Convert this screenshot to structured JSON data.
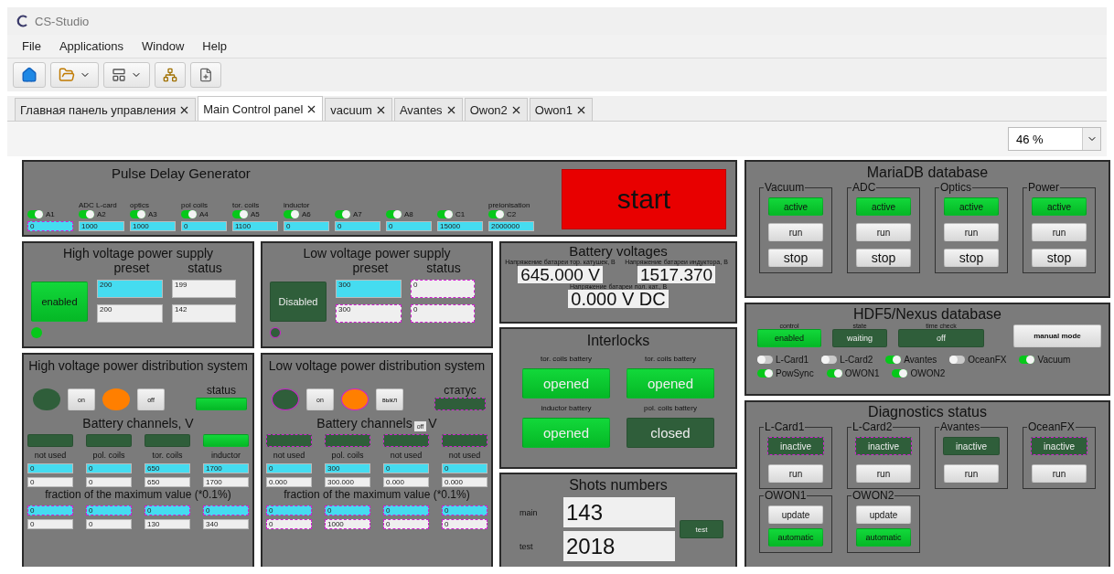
{
  "window": {
    "title": "CS-Studio"
  },
  "menu": [
    "File",
    "Applications",
    "Window",
    "Help"
  ],
  "tabs": [
    {
      "label": "Главная панель управления",
      "selected": false
    },
    {
      "label": "Main Control panel",
      "selected": true
    },
    {
      "label": "vacuum",
      "selected": false
    },
    {
      "label": "Avantes",
      "selected": false
    },
    {
      "label": "Owon2",
      "selected": false
    },
    {
      "label": "Owon1",
      "selected": false
    }
  ],
  "zoom": {
    "value": "46 %"
  },
  "pdg": {
    "title": "Pulse Delay Generator",
    "start_button": "start",
    "channels": [
      {
        "label": "A1",
        "on": true,
        "value": "0",
        "alarm": true
      },
      {
        "header": "ADC L-card",
        "label": "A2",
        "on": true,
        "value": "1000",
        "alarm": false
      },
      {
        "header": "optics",
        "label": "A3",
        "on": true,
        "value": "1000",
        "alarm": false
      },
      {
        "header": "pol coils",
        "label": "A4",
        "on": true,
        "value": "0",
        "alarm": false
      },
      {
        "header": "tor. coils",
        "label": "A5",
        "on": true,
        "value": "1100",
        "alarm": false
      },
      {
        "header": "inductor",
        "label": "A6",
        "on": true,
        "value": "0",
        "alarm": false
      },
      {
        "label": "A7",
        "on": true,
        "value": "0",
        "alarm": false
      },
      {
        "label": "A8",
        "on": true,
        "value": "0",
        "alarm": false
      },
      {
        "label": "C1",
        "on": true,
        "value": "15000",
        "alarm": false
      },
      {
        "header": "preionisation",
        "label": "C2",
        "on": true,
        "value": "2000000",
        "alarm": false
      }
    ]
  },
  "supplies": [
    {
      "title": "High voltage power supply",
      "preset_label": "preset",
      "status_label": "status",
      "button": "enabled",
      "on": true,
      "led_alarm": false,
      "preset": [
        {
          "value": "200",
          "editable": true,
          "alarm": false
        },
        {
          "value": "200",
          "editable": false,
          "alarm": false
        }
      ],
      "status": [
        {
          "value": "199",
          "editable": false,
          "alarm": false
        },
        {
          "value": "142",
          "editable": false,
          "alarm": false
        }
      ]
    },
    {
      "title": "Low voltage power supply",
      "preset_label": "preset",
      "status_label": "status",
      "button": "Disabled",
      "on": false,
      "led_alarm": true,
      "preset": [
        {
          "value": "300",
          "editable": true,
          "alarm": false
        },
        {
          "value": "300",
          "editable": false,
          "alarm": true
        }
      ],
      "status": [
        {
          "value": "0",
          "editable": false,
          "alarm": true
        },
        {
          "value": "0",
          "editable": false,
          "alarm": true
        }
      ]
    }
  ],
  "distribution": [
    {
      "title": "High voltage power distribution system",
      "on_button": "on",
      "off_button": "off",
      "alarm": false,
      "status_label": "status",
      "status_on": true,
      "channels_title": "Battery channels, V",
      "fraction_title": "fraction of the maximum value  (*0.1%)",
      "channels": [
        {
          "name": "not used",
          "on": false,
          "alarm": false,
          "set": "0",
          "read": "0",
          "fraction_set": "0",
          "fraction_read": "0",
          "fraction_alarm": true
        },
        {
          "name": "pol. coils",
          "on": false,
          "alarm": false,
          "set": "0",
          "read": "0",
          "fraction_set": "0",
          "fraction_read": "0",
          "fraction_alarm": true
        },
        {
          "name": "tor. coils",
          "on": false,
          "alarm": false,
          "set": "650",
          "read": "650",
          "fraction_set": "0",
          "fraction_read": "130",
          "fraction_alarm": true
        },
        {
          "name": "inductor",
          "on": true,
          "alarm": false,
          "set": "1700",
          "read": "1700",
          "fraction_set": "0",
          "fraction_read": "340",
          "fraction_alarm": true
        }
      ]
    },
    {
      "title": "Low voltage power distribution system",
      "on_button": "on",
      "off_button": "выкл",
      "alarm": true,
      "status_label": "статус",
      "status_on": false,
      "channels_title": "Battery channels",
      "tooltip": "off",
      "channels_tail": "V",
      "fraction_title": "fraction of the maximum value  (*0.1%)",
      "channels": [
        {
          "name": "not used",
          "on": false,
          "alarm": true,
          "set": "0",
          "read": "0.000",
          "fraction_set": "0",
          "fraction_read": "0",
          "fraction_alarm": true
        },
        {
          "name": "pol. coils",
          "on": false,
          "alarm": true,
          "set": "300",
          "read": "300.000",
          "fraction_set": "0",
          "fraction_read": "1000",
          "fraction_alarm": true
        },
        {
          "name": "not used",
          "on": false,
          "alarm": true,
          "set": "0",
          "read": "0.000",
          "fraction_set": "0",
          "fraction_read": "0",
          "fraction_alarm": true
        },
        {
          "name": "not used",
          "on": false,
          "alarm": true,
          "set": "0",
          "read": "0.000",
          "fraction_set": "0",
          "fraction_read": "0",
          "fraction_alarm": true
        }
      ]
    }
  ],
  "battery_voltages": {
    "title": "Battery voltages",
    "readings": [
      {
        "label": "Напряжение батареи тор. катушек, В",
        "value": "645.000 V"
      },
      {
        "label": "Напряжение батареи индуктора, В",
        "value": "1517.370"
      },
      {
        "label": "Напряжение батареи пол. кат., В",
        "value": "0.000 V DC"
      }
    ]
  },
  "interlocks": {
    "title": "Interlocks",
    "items": [
      {
        "label": "tor. coils battery",
        "state": "opened",
        "on": true
      },
      {
        "label": "tor. coils battery",
        "state": "opened",
        "on": true
      },
      {
        "label": "inductor battery",
        "state": "opened",
        "on": true
      },
      {
        "label": "pol. coils battery",
        "state": "closed",
        "on": false
      }
    ]
  },
  "shots": {
    "title": "Shots numbers",
    "rows": [
      {
        "label": "main",
        "value": "143"
      },
      {
        "label": "test",
        "value": "2018"
      }
    ],
    "test_button": "test"
  },
  "mariadb": {
    "title": "MariaDB database",
    "groups": [
      {
        "name": "Vacuum",
        "status": "active",
        "on": true,
        "run": "run",
        "stop": "stop"
      },
      {
        "name": "ADC",
        "status": "active",
        "on": true,
        "run": "run",
        "stop": "stop"
      },
      {
        "name": "Optics",
        "status": "active",
        "on": true,
        "run": "run",
        "stop": "stop"
      },
      {
        "name": "Power",
        "status": "active",
        "on": true,
        "run": "run",
        "stop": "stop"
      }
    ]
  },
  "hdf5": {
    "title": "HDF5/Nexus database",
    "controls": [
      {
        "label": "control",
        "value": "enabled",
        "on": true
      },
      {
        "label": "state",
        "value": "waiting",
        "on": false
      },
      {
        "label": "time check",
        "value": "off",
        "on": false
      }
    ],
    "manual_button": "manual mode",
    "toggles": [
      {
        "label": "L-Card1",
        "on": false
      },
      {
        "label": "L-Card2",
        "on": false
      },
      {
        "label": "Avantes",
        "on": true
      },
      {
        "label": "OceanFX",
        "on": false
      },
      {
        "label": "Vacuum",
        "on": true
      },
      {
        "label": "PowSync",
        "on": true
      },
      {
        "label": "OWON1",
        "on": true
      },
      {
        "label": "OWON2",
        "on": true
      }
    ]
  },
  "diagnostics": {
    "title": "Diagnostics status",
    "groups": [
      {
        "name": "L-Card1",
        "status": "inactive",
        "on": false,
        "alarm": true,
        "run": "run"
      },
      {
        "name": "L-Card2",
        "status": "inactive",
        "on": false,
        "alarm": true,
        "run": "run"
      },
      {
        "name": "Avantes",
        "status": "inactive",
        "on": false,
        "alarm": false,
        "run": "run"
      },
      {
        "name": "OceanFX",
        "status": "inactive",
        "on": false,
        "alarm": true,
        "run": "run"
      }
    ],
    "scopes": [
      {
        "name": "OWON1",
        "update": "update",
        "mode": "automatic",
        "on": true
      },
      {
        "name": "OWON2",
        "update": "update",
        "mode": "automatic",
        "on": true
      }
    ]
  }
}
